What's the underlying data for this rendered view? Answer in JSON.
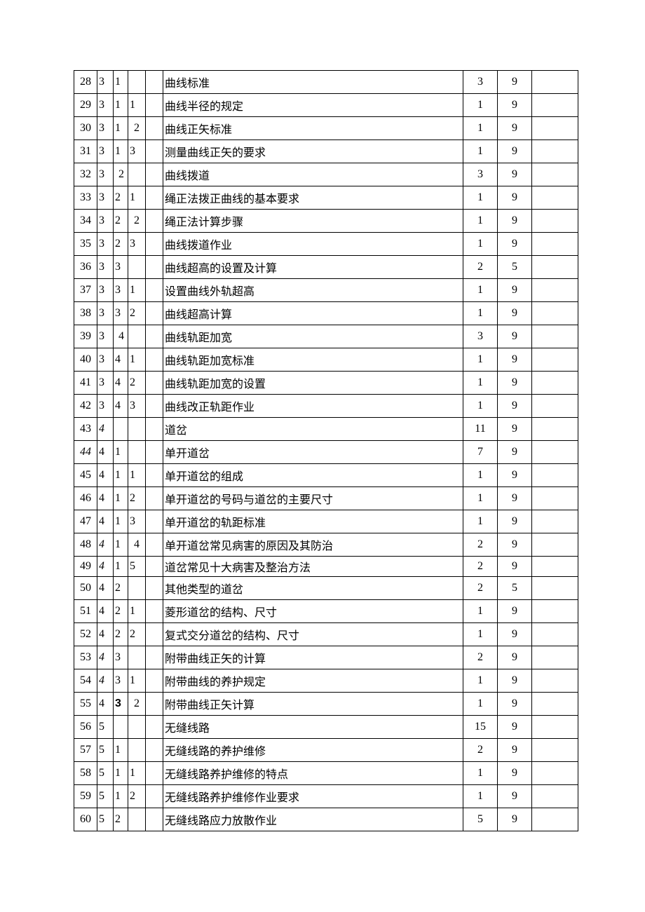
{
  "rows": [
    {
      "seq": "28",
      "l1": "3",
      "l2": "1",
      "l3": "",
      "l4": "",
      "title": "曲线标准",
      "va": "3",
      "vb": "9"
    },
    {
      "seq": "29",
      "l1": "3",
      "l2": "1",
      "l3": "1",
      "l4": "",
      "title": "曲线半径的规定",
      "va": "1",
      "vb": "9"
    },
    {
      "seq": "30",
      "l1": "3",
      "l2": "1",
      "l3": "2",
      "l3align": "center",
      "l4": "",
      "title": "曲线正矢标准",
      "va": "1",
      "vb": "9"
    },
    {
      "seq": "31",
      "l1": "3",
      "l2": "1",
      "l3": "3",
      "l4": "",
      "title": "测量曲线正矢的要求",
      "va": "1",
      "vb": "9"
    },
    {
      "seq": "32",
      "l1": "3",
      "l2": "2",
      "l2align": "center",
      "l3": "",
      "l4": "",
      "title": "曲线拨道",
      "va": "3",
      "vb": "9"
    },
    {
      "seq": "33",
      "l1": "3",
      "l2": "2",
      "l3": "1",
      "l4": "",
      "title": "绳正法拨正曲线的基本要求",
      "va": "1",
      "vb": "9"
    },
    {
      "seq": "34",
      "l1": "3",
      "l2": "2",
      "l3": "2",
      "l3align": "center",
      "l4": "",
      "title": "绳正法计算步骤",
      "va": "1",
      "vb": "9"
    },
    {
      "seq": "35",
      "l1": "3",
      "l2": "2",
      "l3": "3",
      "l4": "",
      "title": "曲线拨道作业",
      "va": "1",
      "vb": "9"
    },
    {
      "seq": "36",
      "l1": "3",
      "l2": "3",
      "l3": "",
      "l4": "",
      "title": "曲线超高的设置及计算",
      "va": "2",
      "vb": "5"
    },
    {
      "seq": "37",
      "l1": "3",
      "l2": "3",
      "l3": "1",
      "l4": "",
      "title": "设置曲线外轨超高",
      "va": "1",
      "vb": "9"
    },
    {
      "seq": "38",
      "l1": "3",
      "l2": "3",
      "l3": "2",
      "l4": "",
      "title": "曲线超高计算",
      "va": "1",
      "vb": "9"
    },
    {
      "seq": "39",
      "l1": "3",
      "l2": "4",
      "l2align": "center",
      "l3": "",
      "l4": "",
      "title": "曲线轨距加宽",
      "va": "3",
      "vb": "9"
    },
    {
      "seq": "40",
      "l1": "3",
      "l2": "4",
      "l3": "1",
      "l4": "",
      "title": "曲线轨距加宽标准",
      "va": "1",
      "vb": "9"
    },
    {
      "seq": "41",
      "l1": "3",
      "l2": "4",
      "l3": "2",
      "l4": "",
      "title": "曲线轨距加宽的设置",
      "va": "1",
      "vb": "9"
    },
    {
      "seq": "42",
      "l1": "3",
      "l2": "4",
      "l3": "3",
      "l4": "",
      "title": "曲线改正轨距作业",
      "va": "1",
      "vb": "9"
    },
    {
      "seq": "43",
      "l1": "4",
      "l1style": "italic",
      "l2": "",
      "l3": "",
      "l4": "",
      "title": "道岔",
      "va": "11",
      "vb": "9"
    },
    {
      "seq": "44",
      "seqstyle": "italic",
      "l1": "4",
      "l2": "1",
      "l3": "",
      "l4": "",
      "title": "单开道岔",
      "va": "7",
      "vb": "9"
    },
    {
      "seq": "45",
      "l1": "4",
      "l2": "1",
      "l3": "1",
      "l4": "",
      "title": "单开道岔的组成",
      "va": "1",
      "vb": "9"
    },
    {
      "seq": "46",
      "l1": "4",
      "l2": "1",
      "l3": "2",
      "l4": "",
      "title": "单开道岔的号码与道岔的主要尺寸",
      "va": "1",
      "vb": "9"
    },
    {
      "seq": "47",
      "l1": "4",
      "l2": "1",
      "l3": "3",
      "l4": "",
      "title": "单开道岔的轨距标准",
      "va": "1",
      "vb": "9"
    },
    {
      "seq": "48",
      "l1": "4",
      "l1style": "italic",
      "l2": "1",
      "l3": "4",
      "l3align": "center",
      "l4": "",
      "title": "单开道岔常见病害的原因及其防治",
      "va": "2",
      "vb": "9"
    },
    {
      "seq": "49",
      "l1": "4",
      "l1style": "italic",
      "l2": "1",
      "l3": "5",
      "l4": "",
      "title": "道岔常见十大病害及整治方法",
      "va": "2",
      "vb": "9",
      "short": true
    },
    {
      "seq": "50",
      "l1": "4",
      "l2": "2",
      "l3": "",
      "l4": "",
      "title": "其他类型的道岔",
      "va": "2",
      "vb": "5"
    },
    {
      "seq": "51",
      "l1": "4",
      "l2": "2",
      "l3": "1",
      "l4": "",
      "title": "菱形道岔的结构、尺寸",
      "va": "1",
      "vb": "9"
    },
    {
      "seq": "52",
      "l1": "4",
      "l2": "2",
      "l3": "2",
      "l4": "",
      "title": "复式交分道岔的结构、尺寸",
      "va": "1",
      "vb": "9"
    },
    {
      "seq": "53",
      "l1": "4",
      "l1style": "italic",
      "l2": "3",
      "l3": "",
      "l4": "",
      "title": "附带曲线正矢的计算",
      "va": "2",
      "vb": "9"
    },
    {
      "seq": "54",
      "l1": "4",
      "l1style": "italic",
      "l2": "3",
      "l3": "1",
      "l4": "",
      "title": "附带曲线的养护规定",
      "va": "1",
      "vb": "9"
    },
    {
      "seq": "55",
      "l1": "4",
      "l2": "3",
      "l2style": "bold-sans",
      "l3": "2",
      "l3align": "center",
      "l4": "",
      "title": "附带曲线正矢计算",
      "va": "1",
      "vb": "9"
    },
    {
      "seq": "56",
      "l1": "5",
      "l2": "",
      "l3": "",
      "l4": "",
      "title": "无缝线路",
      "va": "15",
      "vb": "9"
    },
    {
      "seq": "57",
      "l1": "5",
      "l2": "1",
      "l3": "",
      "l4": "",
      "title": "无缝线路的养护维修",
      "va": "2",
      "vb": "9"
    },
    {
      "seq": "58",
      "l1": "5",
      "l2": "1",
      "l3": "1",
      "l4": "",
      "title": "无缝线路养护维修的特点",
      "va": "1",
      "vb": "9"
    },
    {
      "seq": "59",
      "l1": "5",
      "l2": "1",
      "l3": "2",
      "l4": "",
      "title": "无缝线路养护维修作业要求",
      "va": "1",
      "vb": "9"
    },
    {
      "seq": "60",
      "l1": "5",
      "l2": "2",
      "l3": "",
      "l4": "",
      "title": "无缝线路应力放散作业",
      "va": "5",
      "vb": "9"
    }
  ]
}
